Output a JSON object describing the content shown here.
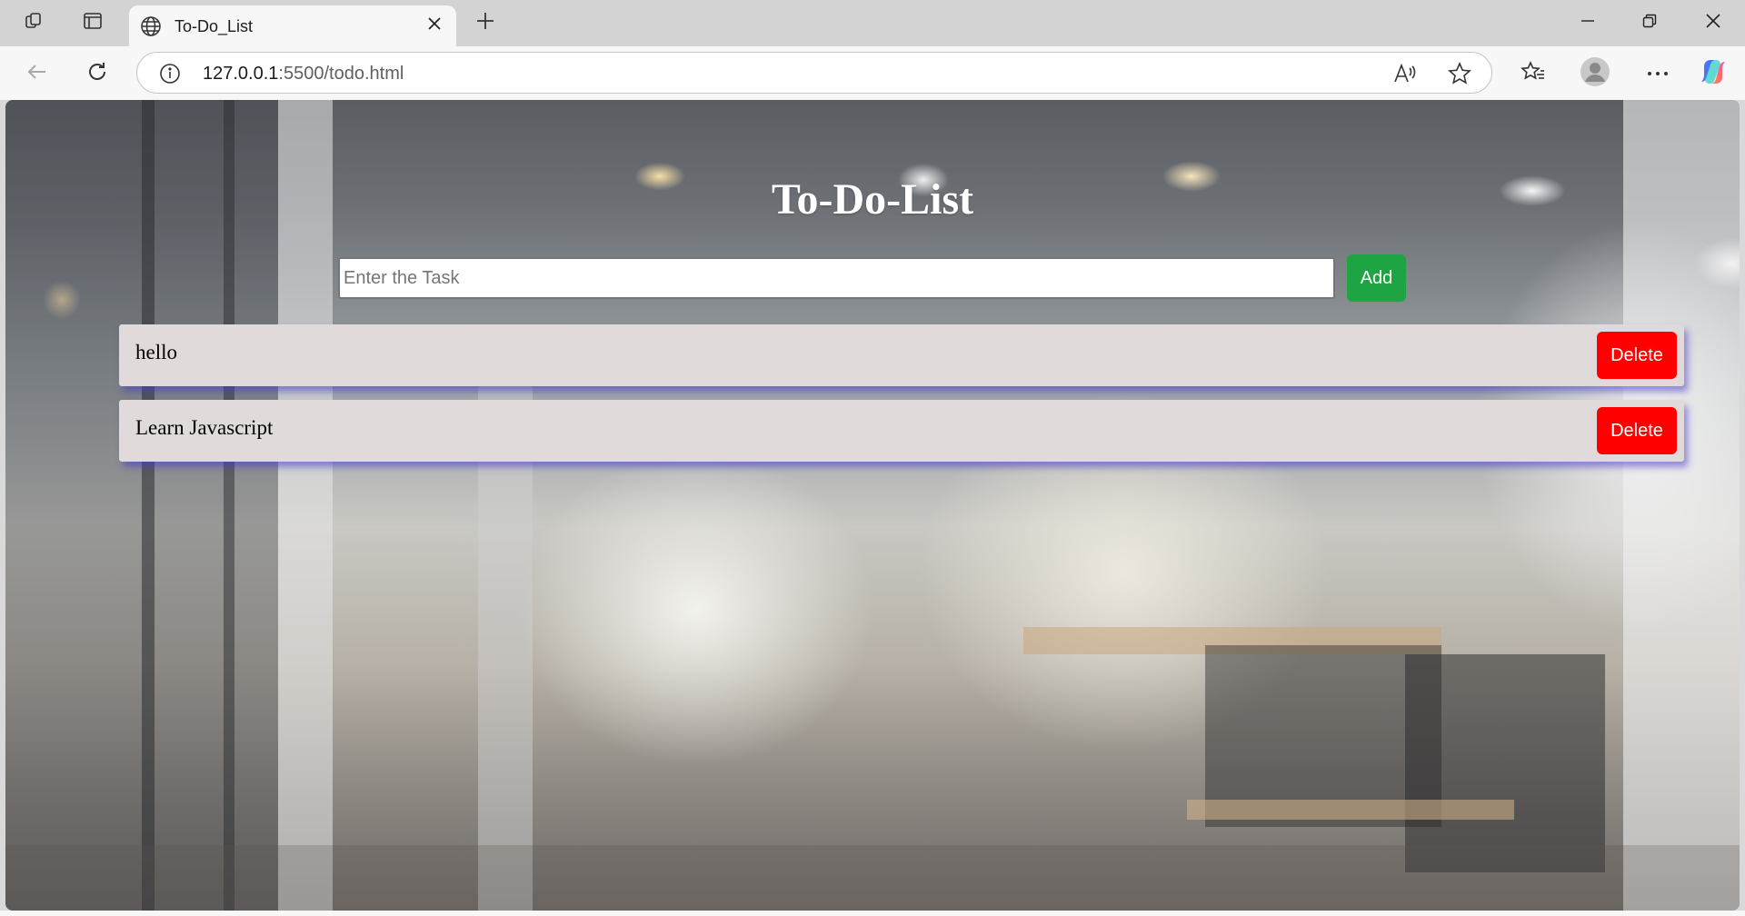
{
  "browser": {
    "tab": {
      "title": "To-Do_List"
    },
    "address": {
      "host": "127.0.0.1",
      "rest": ":5500/todo.html"
    },
    "icons": {
      "workspaces": "workspaces-icon",
      "tab_actions": "tab-actions-icon",
      "site": "globe-icon",
      "close_tab": "close-icon",
      "new_tab": "plus-icon",
      "minimize": "minimize-icon",
      "restore": "restore-icon",
      "close_window": "close-icon",
      "back": "back-arrow-icon",
      "refresh": "refresh-icon",
      "info": "info-icon",
      "read_aloud": "read-aloud-icon",
      "favorite": "star-icon",
      "favorites": "favorites-icon",
      "profile": "profile-icon",
      "more": "more-icon",
      "copilot": "copilot-icon"
    }
  },
  "app": {
    "heading": "To-Do-List",
    "input": {
      "placeholder": "Enter the Task",
      "value": ""
    },
    "add_label": "Add",
    "tasks": [
      {
        "text": "hello",
        "delete_label": "Delete"
      },
      {
        "text": "Learn Javascript",
        "delete_label": "Delete"
      }
    ],
    "colors": {
      "add": "#1fa443",
      "delete": "#ff0000",
      "item_bg": "#e0dadb",
      "item_shadow": "#463cc8"
    }
  }
}
